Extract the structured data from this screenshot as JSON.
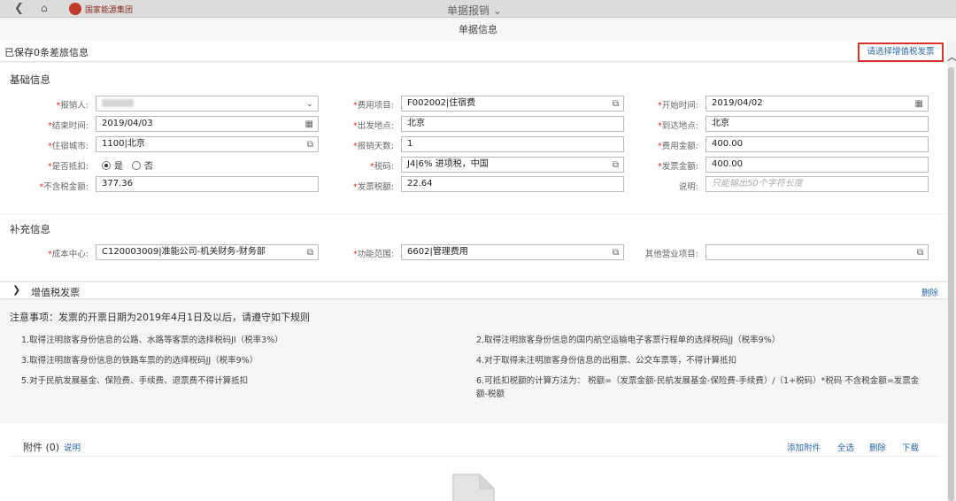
{
  "window": {
    "title": "单据报销",
    "company": "国家能源集团"
  },
  "subheader": "单据信息",
  "saved_status": "已保存0条差旅信息",
  "select_invoice_button": "请选择增值税发票",
  "basic": {
    "title": "基础信息",
    "col1": [
      {
        "label": "报销人:",
        "value": "",
        "type": "select"
      },
      {
        "label": "结束时间:",
        "value": "2019/04/03",
        "type": "date"
      },
      {
        "label": "住宿城市:",
        "value": "1100|北京",
        "type": "lookup"
      },
      {
        "label": "是否抵扣:",
        "type": "radio",
        "options": [
          "是",
          "否"
        ],
        "selected": "是"
      },
      {
        "label": "不含税金额:",
        "value": "377.36",
        "type": "text"
      }
    ],
    "col2": [
      {
        "label": "费用项目:",
        "value": "F002002|住宿费",
        "type": "lookup"
      },
      {
        "label": "出发地点:",
        "value": "北京",
        "type": "text"
      },
      {
        "label": "报销天数:",
        "value": "1",
        "type": "text"
      },
      {
        "label": "税码:",
        "value": "J4|6% 进项税，中国",
        "type": "lookup"
      },
      {
        "label": "发票税额:",
        "value": "22.64",
        "type": "text"
      }
    ],
    "col3": [
      {
        "label": "开始时间:",
        "value": "2019/04/02",
        "type": "date",
        "required": true
      },
      {
        "label": "到达地点:",
        "value": "北京",
        "type": "text",
        "required": true
      },
      {
        "label": "费用金额:",
        "value": "400.00",
        "type": "text",
        "required": true
      },
      {
        "label": "发票金额:",
        "value": "400.00",
        "type": "text",
        "required": true
      },
      {
        "label": "说明:",
        "placeholder": "只能输出50个字符长度",
        "type": "text",
        "required": false
      }
    ]
  },
  "supplement": {
    "title": "补充信息",
    "cost_center_label": "成本中心:",
    "cost_center_value": "C120003009|准能公司-机关财务-财务部",
    "functional_area_label": "功能范围:",
    "functional_area_value": "6602|管理费用",
    "other_business_label": "其他营业项目:",
    "other_business_value": ""
  },
  "vat": {
    "label": "增值税发票",
    "delete": "删除"
  },
  "notes": {
    "heading": "注意事项：发票的开票日期为2019年4月1日及以后，请遵守如下规则",
    "rules": [
      "1.取得注明旅客身份信息的公路、水路等客票的选择税码JI（税率3%）",
      "2.取得注明旅客身份信息的国内航空运输电子客票行程单的选择税码JJ（税率9%）",
      "3.取得注明旅客身份信息的铁路车票的的选择税码JJ（税率9%）",
      "4.对于取得未注明旅客身份信息的出租票、公交车票等，不得计算抵扣",
      "5.对于民航发展基金、保险费、手续费、退票费不得计算抵扣",
      "6.可抵扣税额的计算方法为： 税额=（发票金额-民航发展基金-保险费-手续费）/（1+税码）*税码 不含税金额=发票金额-税额"
    ]
  },
  "attachments": {
    "title": "附件 (0)",
    "help": "说明",
    "actions": [
      "添加附件",
      "全选",
      "删除",
      "下载"
    ]
  },
  "colors": {
    "accent_link": "#2a66a8",
    "required": "#d9342b",
    "highlight_box": "#d9342b"
  }
}
